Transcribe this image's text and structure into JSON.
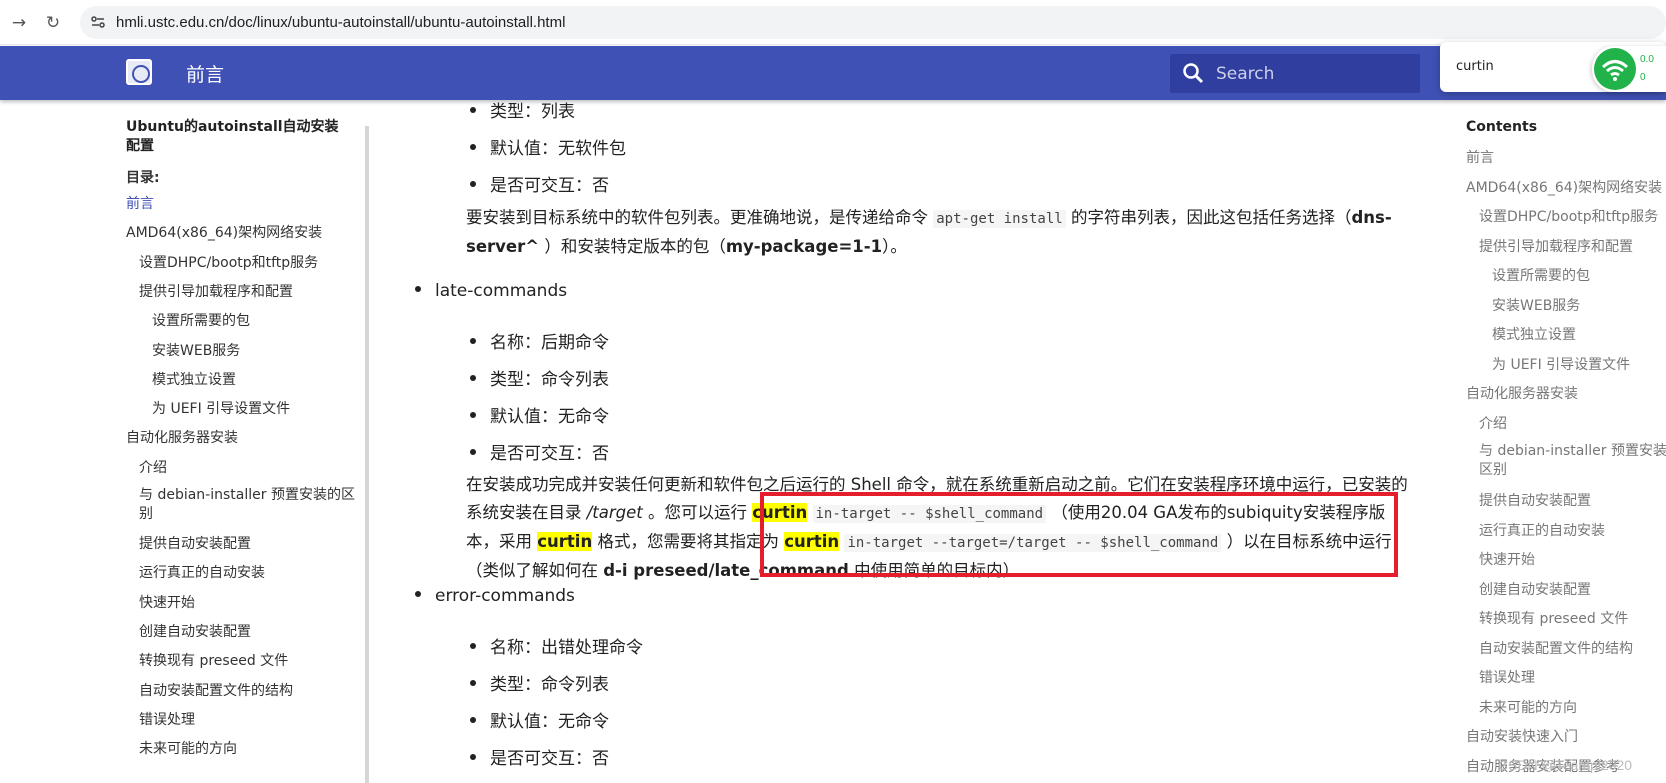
{
  "browser": {
    "url": "hmli.ustc.edu.cn/doc/linux/ubuntu-autoinstall/ubuntu-autoinstall.html"
  },
  "header": {
    "title": "前言",
    "search_placeholder": "Search",
    "brand_color": "#3f51b5"
  },
  "find_bar": {
    "query": "curtin"
  },
  "net_widget": {
    "up": "0.0",
    "down": "0"
  },
  "left_nav": {
    "doc_title": "Ubuntu的autoinstall自动安装配置",
    "toc_label": "目录:",
    "items": [
      {
        "label": "前言",
        "level": 0,
        "active": true
      },
      {
        "label": "AMD64(x86_64)架构网络安装",
        "level": 0
      },
      {
        "label": "设置DHPC/bootp和tftp服务",
        "level": 1
      },
      {
        "label": "提供引导加载程序和配置",
        "level": 1
      },
      {
        "label": "设置所需要的包",
        "level": 2
      },
      {
        "label": "安装WEB服务",
        "level": 2
      },
      {
        "label": "模式独立设置",
        "level": 2
      },
      {
        "label": "为 UEFI 引导设置文件",
        "level": 2
      },
      {
        "label": "自动化服务器安装",
        "level": 0
      },
      {
        "label": "介绍",
        "level": 1
      },
      {
        "label": "与 debian-installer 预置安装的区别",
        "level": 1
      },
      {
        "label": "提供自动安装配置",
        "level": 1
      },
      {
        "label": "运行真正的自动安装",
        "level": 1
      },
      {
        "label": "快速开始",
        "level": 1
      },
      {
        "label": "创建自动安装配置",
        "level": 1
      },
      {
        "label": "转换现有 preseed 文件",
        "level": 1
      },
      {
        "label": "自动安装配置文件的结构",
        "level": 1
      },
      {
        "label": "错误处理",
        "level": 1
      },
      {
        "label": "未来可能的方向",
        "level": 1
      }
    ]
  },
  "content": {
    "packages_props": [
      "类型：列表",
      "默认值：无软件包",
      "是否可交互：否"
    ],
    "packages_desc": {
      "a": "要安装到目标系统中的软件包列表。更准确地说，是传递给命令",
      "code": "apt-get install",
      "b": "的字符串列表，因此这包括任务选择（",
      "bold1": "dns-server^",
      "c": "）和安装特定版本的包（",
      "bold2": "my-package=1-1",
      "d": "）。"
    },
    "late_commands": {
      "name": "late-commands",
      "props": [
        "名称：后期命令",
        "类型：命令列表",
        "默认值：无命令",
        "是否可交互：否"
      ],
      "desc": {
        "a": "在安装成功完成并安装任何更新和软件包之后运行的 Shell 命令，就在系统重新启动之前。它们在安装程序环境中运行，已安装的系统安装在目录",
        "target": "/target",
        "b": "。您可以运行",
        "hl1": "curtin",
        "code1": "in-target -- $shell_command",
        "c": "（使用20.04 GA发布的subiquity安装程序版本，采用",
        "hl2": "curtin",
        "d": "格式，您需要将其指定为",
        "hl3": "curtin",
        "code2": "in-target --target=/target -- $shell_command",
        "e": "）以在目标系统中运行（类似了解如何在",
        "bold": "d-i preseed/late_command",
        "f": "中使用简单的目标内）"
      }
    },
    "error_commands": {
      "name": "error-commands",
      "props": [
        "名称：出错处理命令",
        "类型：命令列表",
        "默认值：无命令",
        "是否可交互：否"
      ]
    }
  },
  "toc": {
    "heading": "Contents",
    "items": [
      {
        "label": "前言",
        "level": 0
      },
      {
        "label": "AMD64(x86_64)架构网络安装",
        "level": 0
      },
      {
        "label": "设置DHPC/bootp和tftp服务",
        "level": 1
      },
      {
        "label": "提供引导加载程序和配置",
        "level": 1
      },
      {
        "label": "设置所需要的包",
        "level": 2
      },
      {
        "label": "安装WEB服务",
        "level": 2
      },
      {
        "label": "模式独立设置",
        "level": 2
      },
      {
        "label": "为 UEFI 引导设置文件",
        "level": 2
      },
      {
        "label": "自动化服务器安装",
        "level": 0
      },
      {
        "label": "介绍",
        "level": 1
      },
      {
        "label": "与 debian-installer 预置安装区别",
        "level": 1
      },
      {
        "label": "提供自动安装配置",
        "level": 1
      },
      {
        "label": "运行真正的自动安装",
        "level": 1
      },
      {
        "label": "快速开始",
        "level": 1
      },
      {
        "label": "创建自动安装配置",
        "level": 1
      },
      {
        "label": "转换现有 preseed 文件",
        "level": 1
      },
      {
        "label": "自动安装配置文件的结构",
        "level": 1
      },
      {
        "label": "错误处理",
        "level": 1
      },
      {
        "label": "未来可能的方向",
        "level": 1
      },
      {
        "label": "自动安装快速入门",
        "level": 0
      },
      {
        "label": "自动服务器安装配置参考",
        "level": 0
      }
    ]
  },
  "watermark": "CSDN @Teampl2020"
}
